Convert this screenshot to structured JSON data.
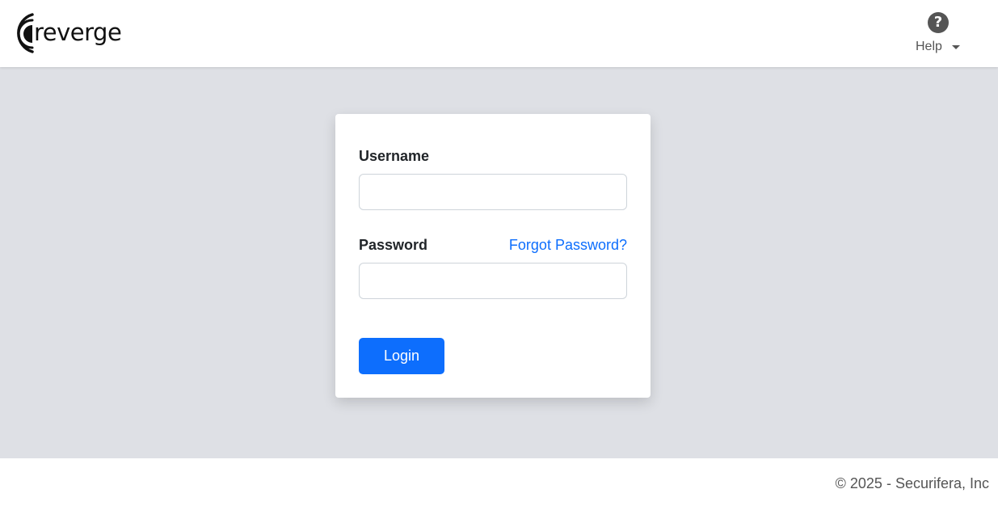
{
  "header": {
    "logo_text": "reverge",
    "help_icon_glyph": "?",
    "help_label": "Help"
  },
  "login_form": {
    "username_label": "Username",
    "username_value": "",
    "username_placeholder": "",
    "password_label": "Password",
    "password_value": "",
    "password_placeholder": "",
    "forgot_password_link": "Forgot Password?",
    "login_button": "Login"
  },
  "footer": {
    "copyright": "© 2025 - Securifera, Inc"
  },
  "colors": {
    "accent": "#0d6efd",
    "page_background": "#dee0e5",
    "card_background": "#ffffff"
  },
  "icons": {
    "logo": "reverge-logo-icon",
    "help": "question-circle-icon",
    "caret": "caret-down-icon"
  }
}
